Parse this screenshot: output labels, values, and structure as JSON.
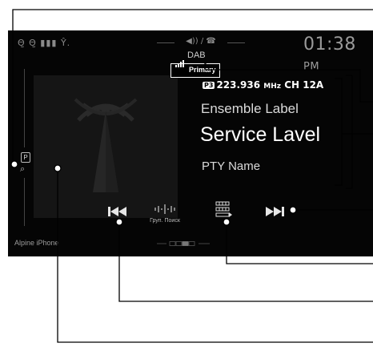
{
  "status_bar": {
    "left_icons": "Θ̺ Θ̺ ▮▮▮ Ŷ.",
    "center_indicator": "◀)) / ☎",
    "time": "01:38",
    "ampm": "PM"
  },
  "source": {
    "name": "DAB"
  },
  "station": {
    "signal_badge": "Primary",
    "frequency_prefix": "P3",
    "frequency": "223.936",
    "frequency_unit": "MHz",
    "channel": "CH 12A",
    "ensemble_label": "Ensemble Label",
    "service_label": "Service Lavel",
    "pty_name": "PTY Name"
  },
  "side_bar": {
    "preset_label": "P"
  },
  "controls": {
    "group_search_label": "Груп. Поиск"
  },
  "bottom": {
    "device_label": "Alpine iPhone"
  },
  "colors": {
    "screen_bg": "#050505",
    "text_primary": "#ffffff",
    "text_secondary": "#dadada",
    "callout_line": "#000000"
  },
  "icons": [
    "antenna-artwork-icon",
    "signal-strength-icon",
    "previous-track-icon",
    "group-search-icon",
    "list-icon",
    "next-track-icon",
    "search-icon"
  ]
}
